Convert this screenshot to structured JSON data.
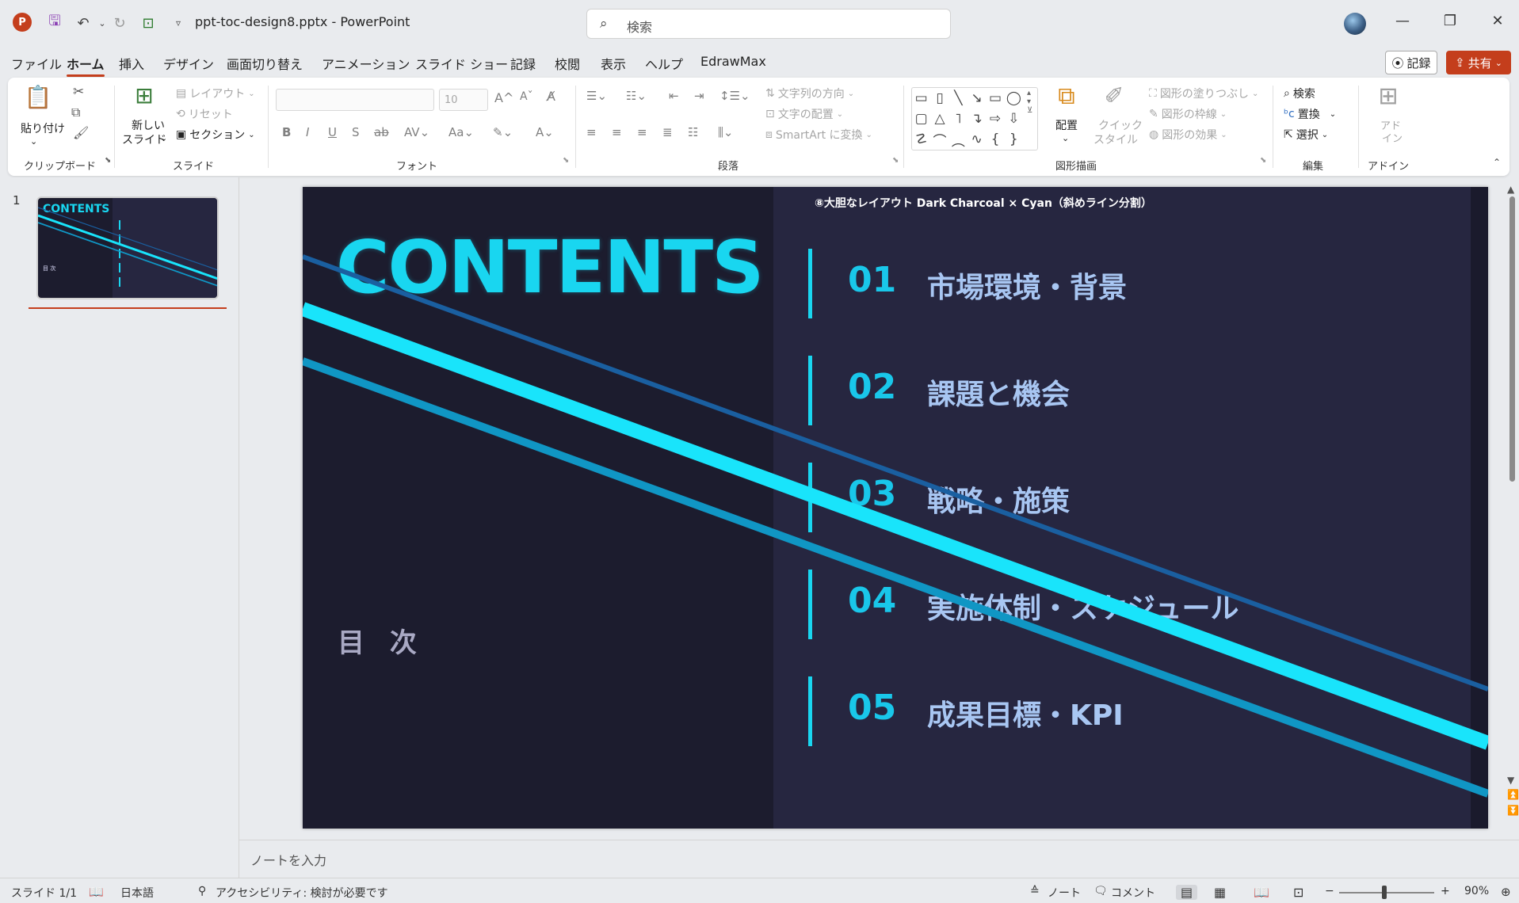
{
  "window": {
    "title": "ppt-toc-design8.pptx  -  PowerPoint",
    "search_placeholder": "検索",
    "controls": {
      "minimize": "—",
      "maximize": "❐",
      "close": "✕"
    }
  },
  "menu": {
    "tabs": [
      "ファイル",
      "ホーム",
      "挿入",
      "デザイン",
      "画面切り替え",
      "アニメーション",
      "スライド ショー",
      "記録",
      "校閲",
      "表示",
      "ヘルプ",
      "EdrawMax"
    ],
    "active_tab": "ホーム",
    "record_label": "記録",
    "share_label": "共有"
  },
  "ribbon": {
    "clipboard": {
      "paste": "貼り付け",
      "label": "クリップボード"
    },
    "slides": {
      "new_slide": "新しい\nスライド",
      "new_slide_line1": "新しい",
      "new_slide_line2": "スライド",
      "layout": "レイアウト",
      "reset": "リセット",
      "section": "セクション",
      "label": "スライド"
    },
    "font": {
      "size": "10",
      "label": "フォント"
    },
    "paragraph": {
      "text_direction": "文字列の方向",
      "align_text": "文字の配置",
      "smartart": "SmartArt に変換",
      "label": "段落"
    },
    "drawing": {
      "arrange": "配置",
      "quick_styles_1": "クイック",
      "quick_styles_2": "スタイル",
      "fill": "図形の塗りつぶし",
      "outline": "図形の枠線",
      "effects": "図形の効果",
      "label": "図形描画"
    },
    "editing": {
      "find": "検索",
      "replace": "置換",
      "select": "選択",
      "label": "編集"
    },
    "addins": {
      "addin_1": "アド",
      "addin_2": "イン",
      "label": "アドイン"
    }
  },
  "thumbnails": [
    {
      "number": "1",
      "heading": "CONTENTS",
      "mokuji": "目 次"
    }
  ],
  "slide": {
    "subtitle": "⑧大胆なレイアウト  Dark Charcoal × Cyan（斜めライン分割）",
    "heading": "CONTENTS",
    "mokuji": "目  次",
    "items": [
      {
        "num": "01",
        "label": "市場環境・背景"
      },
      {
        "num": "02",
        "label": "課題と機会"
      },
      {
        "num": "03",
        "label": "戦略・施策"
      },
      {
        "num": "04",
        "label": "実施体制・スケジュール"
      },
      {
        "num": "05",
        "label": "成果目標・KPI"
      }
    ],
    "colors": {
      "background": "#1c1c2e",
      "panel": "#262640",
      "accent": "#19d6f0",
      "text": "#a8c6f2"
    }
  },
  "notes_placeholder": "ノートを入力",
  "status": {
    "slide_counter": "スライド 1/1",
    "language": "日本語",
    "accessibility": "アクセシビリティ: 検討が必要です",
    "notes": "ノート",
    "comments": "コメント",
    "zoom_minus": "−",
    "zoom_plus": "+",
    "zoom": "90%"
  }
}
